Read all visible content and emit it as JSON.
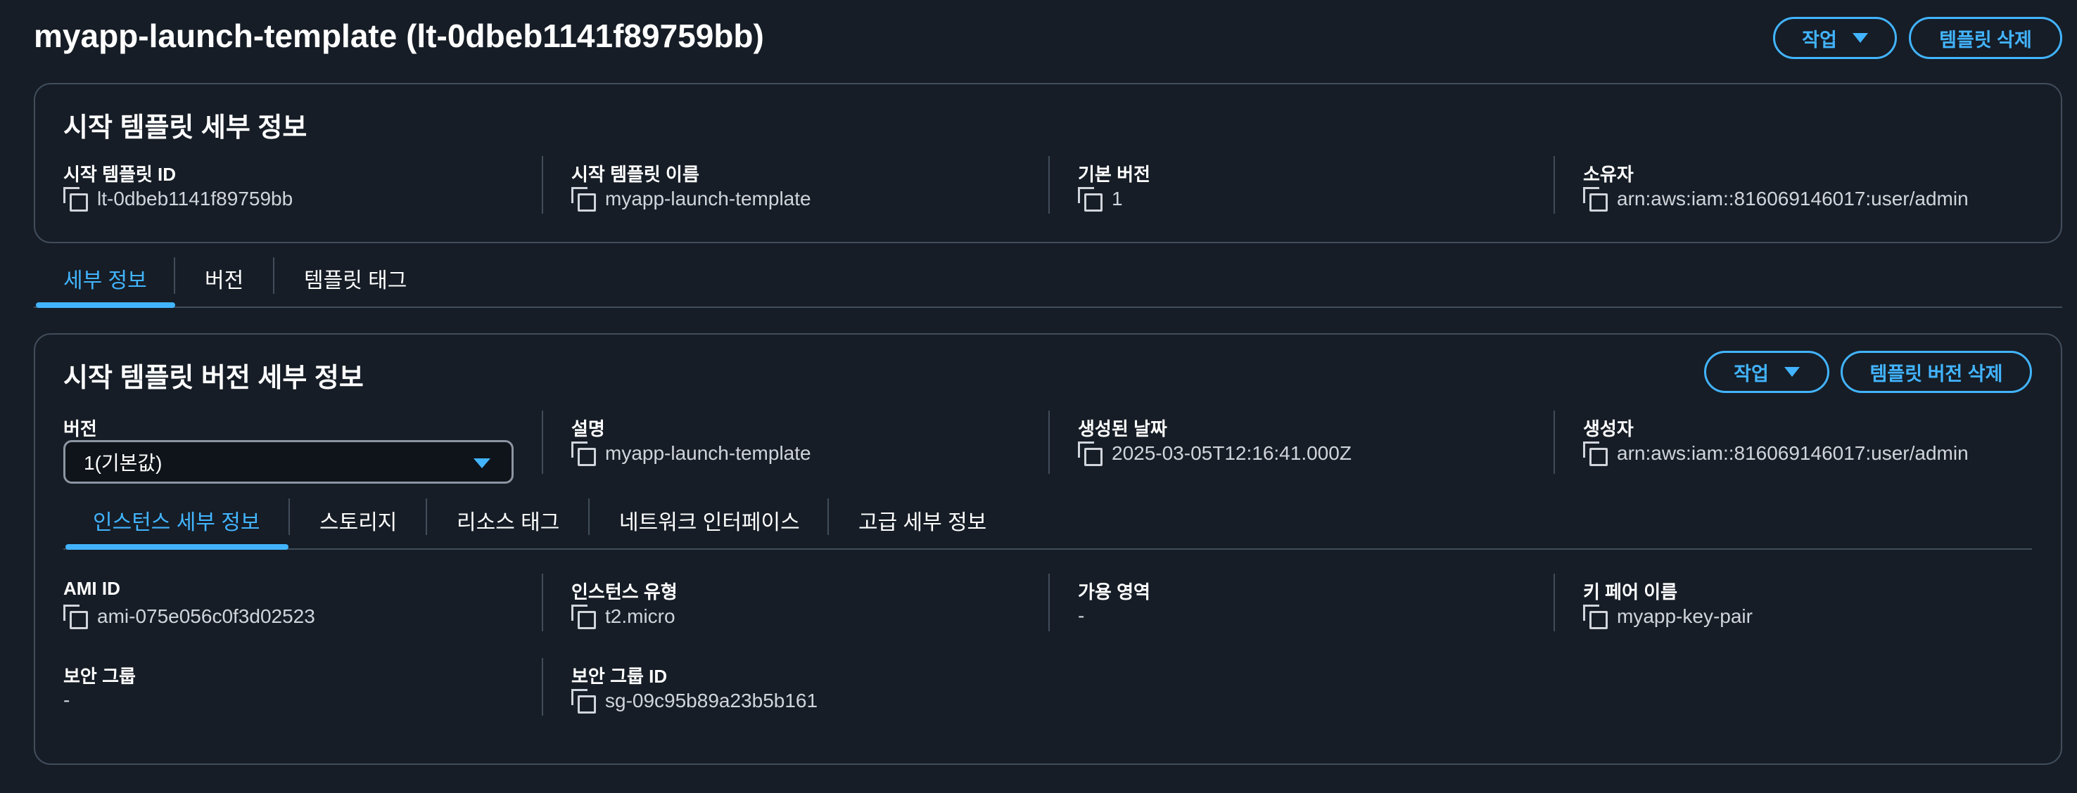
{
  "page": {
    "title": "myapp-launch-template (lt-0dbeb1141f89759bb)",
    "actions_label": "작업",
    "delete_label": "템플릿 삭제"
  },
  "template_details": {
    "title": "시작 템플릿 세부 정보",
    "fields": [
      {
        "label": "시작 템플릿 ID",
        "value": "lt-0dbeb1141f89759bb"
      },
      {
        "label": "시작 템플릿 이름",
        "value": "myapp-launch-template"
      },
      {
        "label": "기본 버전",
        "value": "1"
      },
      {
        "label": "소유자",
        "value": "arn:aws:iam::816069146017:user/admin"
      }
    ]
  },
  "tabs": [
    "세부 정보",
    "버전",
    "템플릿 태그"
  ],
  "version_details": {
    "title": "시작 템플릿 버전 세부 정보",
    "actions_label": "작업",
    "delete_label": "템플릿 버전 삭제",
    "version_label": "버전",
    "version_value": "1(기본값)",
    "fields": [
      {
        "label": "설명",
        "value": "myapp-launch-template"
      },
      {
        "label": "생성된 날짜",
        "value": "2025-03-05T12:16:41.000Z"
      },
      {
        "label": "생성자",
        "value": "arn:aws:iam::816069146017:user/admin"
      }
    ],
    "subtabs": [
      "인스턴스 세부 정보",
      "스토리지",
      "리소스 태그",
      "네트워크 인터페이스",
      "고급 세부 정보"
    ],
    "instance": [
      {
        "label": "AMI ID",
        "value": "ami-075e056c0f3d02523"
      },
      {
        "label": "인스턴스 유형",
        "value": "t2.micro"
      },
      {
        "label": "가용 영역",
        "value": "-"
      },
      {
        "label": "키 페어 이름",
        "value": "myapp-key-pair"
      },
      {
        "label": "보안 그룹",
        "value": "-"
      },
      {
        "label": "보안 그룹 ID",
        "value": "sg-09c95b89a23b5b161"
      }
    ]
  },
  "colors": {
    "background": "#161d26",
    "accent": "#42b4ff",
    "border": "#414d5c",
    "text": "#d1d5db"
  }
}
